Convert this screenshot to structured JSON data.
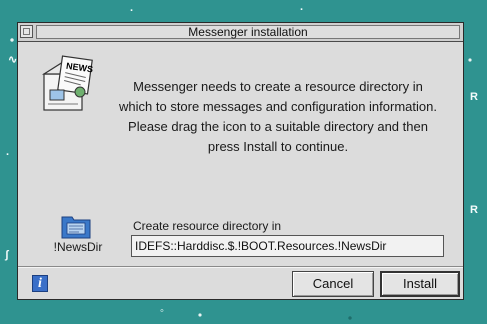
{
  "window": {
    "title": "Messenger installation"
  },
  "dialog": {
    "message": "Messenger needs to create a resource directory in which to store messages and configuration information.  Please drag the icon to a suitable directory and then press Install to continue.",
    "directory_icon_label": "!NewsDir",
    "destination_label": "Create resource directory in",
    "destination_path": "IDEFS::Harddisc.$.!BOOT.Resources.!NewsDir"
  },
  "buttons": {
    "cancel_label": "Cancel",
    "install_label": "Install",
    "info_label": "i"
  },
  "colors": {
    "desktop": "#2f9390",
    "window_bg": "#dcdcdc",
    "info_icon": "#3a6fc8"
  },
  "icons": [
    "close-icon",
    "news-app-icon",
    "directory-icon",
    "info-icon"
  ]
}
